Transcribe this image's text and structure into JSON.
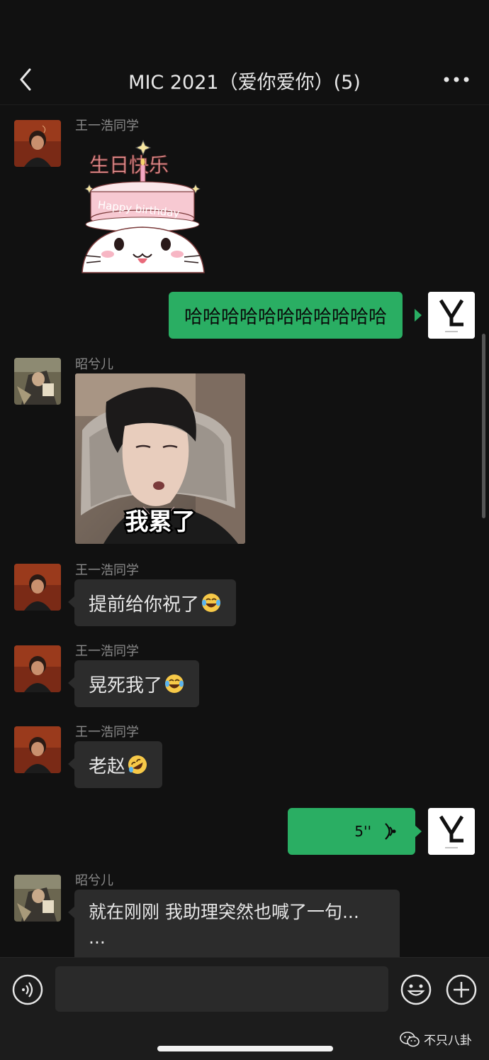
{
  "header": {
    "title": "MIC 2021（爱你爱你）(5)"
  },
  "messages": [
    {
      "sender": "王一浩同学",
      "type": "sticker",
      "sticker": {
        "top_text": "生日快乐",
        "cake_text": "Happy birthday"
      }
    },
    {
      "sender": "me",
      "type": "text",
      "text": "哈哈哈哈哈哈哈哈哈哈哈"
    },
    {
      "sender": "昭兮儿",
      "type": "image",
      "caption": "我累了"
    },
    {
      "sender": "王一浩同学",
      "type": "text",
      "text": "提前给你祝了",
      "emoji": "laughing-tears-emoji"
    },
    {
      "sender": "王一浩同学",
      "type": "text",
      "text": "晃死我了",
      "emoji": "laughing-tears-emoji"
    },
    {
      "sender": "王一浩同学",
      "type": "text",
      "text": "老赵",
      "emoji": "rolling-laugh-emoji"
    },
    {
      "sender": "me",
      "type": "voice",
      "duration": "5''"
    },
    {
      "sender": "昭兮儿",
      "type": "text",
      "line1": "就在刚刚 我助理突然也喊了一句...",
      "line2": "..."
    }
  ],
  "input_bar": {
    "placeholder": ""
  },
  "watermark": {
    "text": "不只八卦"
  },
  "colors": {
    "background": "#111111",
    "incoming_bubble": "#2c2c2c",
    "outgoing_bubble": "#2aae63",
    "sender_name": "#8a8a8a"
  }
}
